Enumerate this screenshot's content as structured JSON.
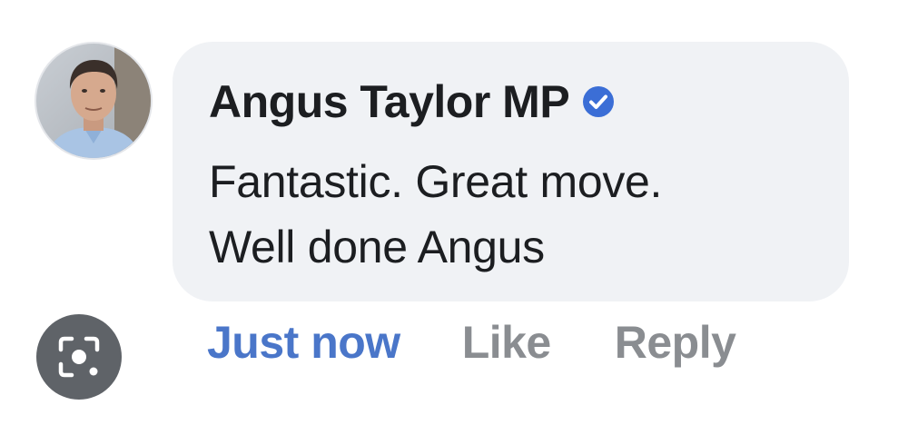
{
  "comment": {
    "author": "Angus Taylor MP",
    "verified_icon": "verified-badge-icon",
    "text_line1": "Fantastic. Great move.",
    "text_line2": "Well done Angus"
  },
  "actions": {
    "timestamp": "Just now",
    "like": "Like",
    "reply": "Reply"
  },
  "overlay": {
    "lens_icon": "visual-search-icon"
  },
  "colors": {
    "bubble_bg": "#f0f2f5",
    "author_text": "#1c1e21",
    "timestamp": "#4a76c9",
    "action_gray": "#8a8d91",
    "verified_blue": "#3b6ed6",
    "lens_bg": "#5f6368"
  }
}
